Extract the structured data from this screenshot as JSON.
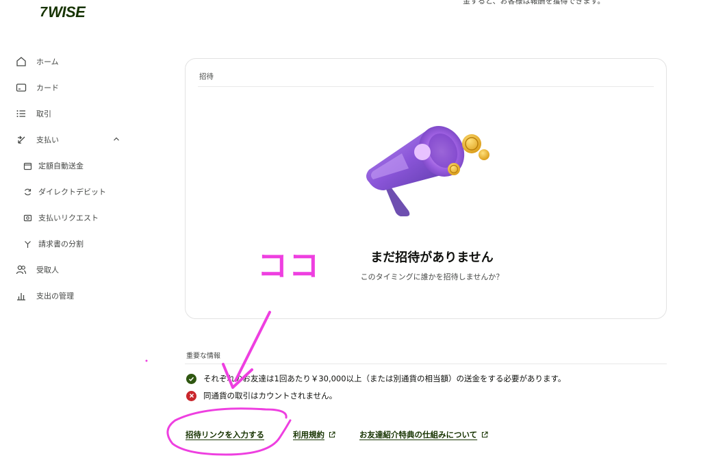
{
  "brand": {
    "logo_flag": "7",
    "logo_text": "WISE"
  },
  "header": {
    "partial_text": "金すると、お客様は報酬を獲得できます。"
  },
  "sidebar": {
    "items": [
      {
        "label": "ホーム",
        "icon": "home-icon"
      },
      {
        "label": "カード",
        "icon": "card-icon"
      },
      {
        "label": "取引",
        "icon": "list-icon"
      },
      {
        "label": "支払い",
        "icon": "transfer-icon",
        "expanded": true
      },
      {
        "label": "定額自動送金",
        "icon": "calendar-icon"
      },
      {
        "label": "ダイレクトデビット",
        "icon": "refresh-icon"
      },
      {
        "label": "支払いリクエスト",
        "icon": "request-icon"
      },
      {
        "label": "請求書の分割",
        "icon": "split-icon"
      },
      {
        "label": "受取人",
        "icon": "people-icon"
      },
      {
        "label": "支出の管理",
        "icon": "chart-icon"
      }
    ]
  },
  "invite_card": {
    "title": "招待",
    "empty_title": "まだ招待がありません",
    "empty_subtitle": "このタイミングに誰かを招待しませんか？"
  },
  "info": {
    "title": "重要な情報",
    "items": [
      {
        "status": "ok",
        "text": "それぞれのお友達は1回あたり￥30,000以上（または別通貨の相当額）の送金をする必要があります。"
      },
      {
        "status": "no",
        "text": "同通貨の取引はカウントされません。"
      }
    ]
  },
  "links": {
    "enter_invite": "招待リンクを入力する",
    "terms": "利用規約",
    "how_it_works": "お友達紹介特典の仕組みについて"
  },
  "annotation": {
    "text": "ココ",
    "color": "#ee3fe0"
  },
  "colors": {
    "brand_green": "#163300",
    "ok_green": "#2f5711",
    "error_red": "#c9262c"
  }
}
